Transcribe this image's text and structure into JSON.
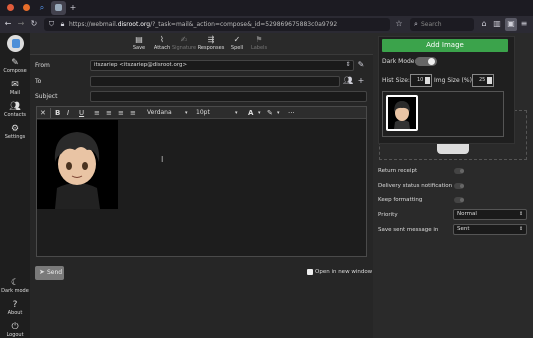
{
  "browser": {
    "url_prefix": "https://webmail.",
    "url_host": "disroot.org",
    "url_rest": "/?_task=mail&_action=compose&_id=529869675883c0a9792",
    "search_placeholder": "Search"
  },
  "sidebar": {
    "items": [
      {
        "label": "Compose",
        "icon": "pencil-icon"
      },
      {
        "label": "Mail",
        "icon": "envelope-icon"
      },
      {
        "label": "Contacts",
        "icon": "contacts-icon"
      },
      {
        "label": "Settings",
        "icon": "gear-icon"
      }
    ],
    "bottom": [
      {
        "label": "Dark mode",
        "icon": "moon-icon"
      },
      {
        "label": "About",
        "icon": "question-icon"
      },
      {
        "label": "Logout",
        "icon": "power-icon"
      }
    ]
  },
  "toolbar": {
    "save": "Save",
    "attach": "Attach",
    "signature": "Signature",
    "responses": "Responses",
    "spell": "Spell",
    "labels": "Labels"
  },
  "compose": {
    "from_label": "From",
    "from_value": "itszariep <itszariep@disroot.org>",
    "to_label": "To",
    "subject_label": "Subject",
    "font_family": "Verdana",
    "font_size": "10pt",
    "send_label": "Send",
    "open_new_window": "Open in new window"
  },
  "popup": {
    "add_image": "Add Image",
    "dark_mode_label": "Dark Mode:",
    "hist_size_label": "Hist Size:",
    "hist_size_value": "10",
    "img_size_label": "Img Size (%):",
    "img_size_value": "25"
  },
  "options": {
    "return_receipt": "Return receipt",
    "delivery_status": "Delivery status notification",
    "keep_formatting": "Keep formatting",
    "priority_label": "Priority",
    "priority_value": "Normal",
    "save_sent_label": "Save sent message in",
    "save_sent_value": "Sent"
  }
}
